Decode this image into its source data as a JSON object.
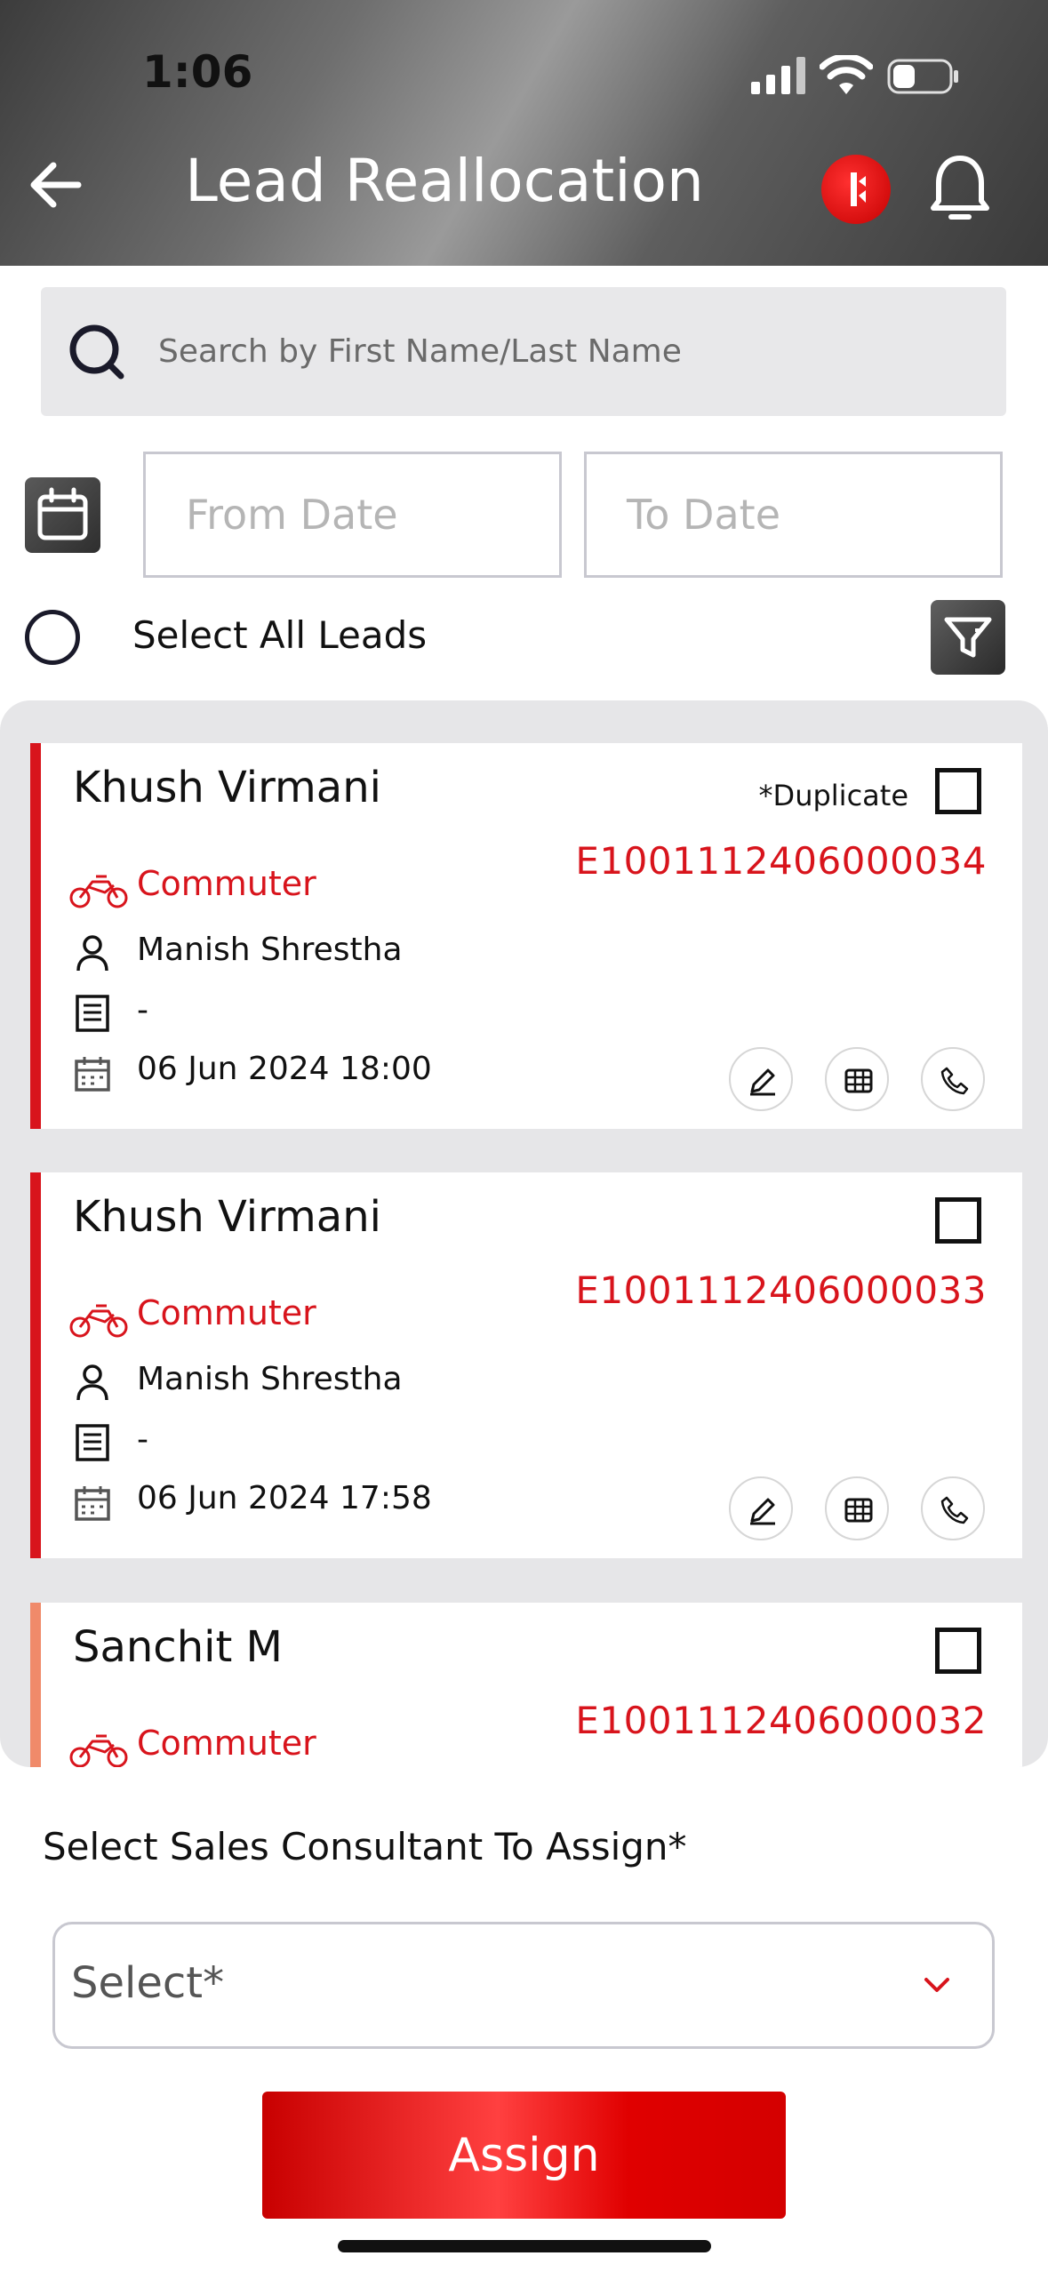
{
  "status_bar": {
    "time": "1:06"
  },
  "header": {
    "title": "Lead Reallocation"
  },
  "search": {
    "placeholder": "Search by First Name/Last Name"
  },
  "filters": {
    "from_placeholder": "From Date",
    "to_placeholder": "To Date",
    "select_all_label": "Select All Leads"
  },
  "leads": [
    {
      "name": "Khush Virmani",
      "tag": "*Duplicate",
      "lead_id": "E1001112406000034",
      "model": "Commuter",
      "consultant": "Manish Shrestha",
      "note": "-",
      "datetime": "06 Jun 2024 18:00",
      "accent": "#d8141c"
    },
    {
      "name": "Khush Virmani",
      "tag": "",
      "lead_id": "E1001112406000033",
      "model": "Commuter",
      "consultant": "Manish Shrestha",
      "note": "-",
      "datetime": "06 Jun 2024 17:58",
      "accent": "#d8141c"
    },
    {
      "name": "Sanchit M",
      "tag": "",
      "lead_id": "E1001112406000032",
      "model": "Commuter",
      "accent": "#f08a6a"
    }
  ],
  "assign": {
    "label": "Select Sales Consultant To Assign*",
    "select_placeholder": "Select*",
    "button_label": "Assign"
  },
  "colors": {
    "brand_red": "#d8141c"
  },
  "icons": [
    "back-arrow-icon",
    "brand-logo-icon",
    "bell-icon",
    "search-icon",
    "calendar-icon",
    "filter-icon",
    "motorcycle-icon",
    "person-icon",
    "document-icon",
    "edit-icon",
    "table-icon",
    "phone-icon",
    "chevron-down-icon"
  ]
}
